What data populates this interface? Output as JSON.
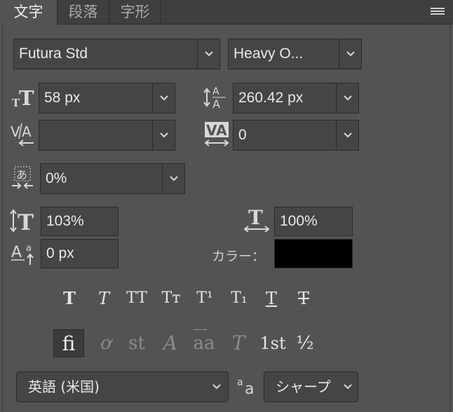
{
  "tabs": [
    {
      "label": "文字",
      "active": true
    },
    {
      "label": "段落"
    },
    {
      "label": "字形"
    }
  ],
  "font_family": "Futura Std",
  "font_style": "Heavy O...",
  "font_size": "58 px",
  "leading": "260.42 px",
  "kerning": "",
  "tracking": "0",
  "tsume": "0%",
  "vertical_scale": "103%",
  "horizontal_scale": "100%",
  "baseline_shift": "0 px",
  "color_label": "カラー：",
  "color_value": "#000000",
  "language": "英語 (米国)",
  "antialias": "シャープ",
  "style_buttons": [
    {
      "name": "faux-bold",
      "glyph": "T"
    },
    {
      "name": "faux-italic",
      "glyph": "T"
    },
    {
      "name": "all-caps",
      "glyph": "TT"
    },
    {
      "name": "small-caps",
      "glyph": "Tт"
    },
    {
      "name": "superscript",
      "glyph": "T¹"
    },
    {
      "name": "subscript",
      "glyph": "T₁"
    },
    {
      "name": "underline",
      "glyph": "T"
    },
    {
      "name": "strikethrough",
      "glyph": "T"
    }
  ],
  "opentype_buttons": [
    {
      "name": "standard-ligatures",
      "glyph": "fi",
      "active": true
    },
    {
      "name": "contextual-alternates",
      "glyph": "ơ"
    },
    {
      "name": "discretionary-ligatures",
      "glyph": "st"
    },
    {
      "name": "swash",
      "glyph": "A"
    },
    {
      "name": "stylistic-alternates",
      "glyph": "aa"
    },
    {
      "name": "titling-alternates",
      "glyph": "T"
    },
    {
      "name": "ordinals",
      "glyph": "1st"
    },
    {
      "name": "fractions",
      "glyph": "½"
    }
  ],
  "icons": [
    "font-size-icon",
    "leading-icon",
    "kerning-icon",
    "tracking-icon",
    "tsume-icon",
    "vertical-scale-icon",
    "horizontal-scale-icon",
    "baseline-shift-icon",
    "antialias-icon",
    "panel-menu-icon",
    "chevron-down-icon"
  ],
  "colors": {
    "panel": "#535353",
    "field": "#454545",
    "tabbar": "#3f3f3f",
    "text": "#e8e8e8"
  }
}
